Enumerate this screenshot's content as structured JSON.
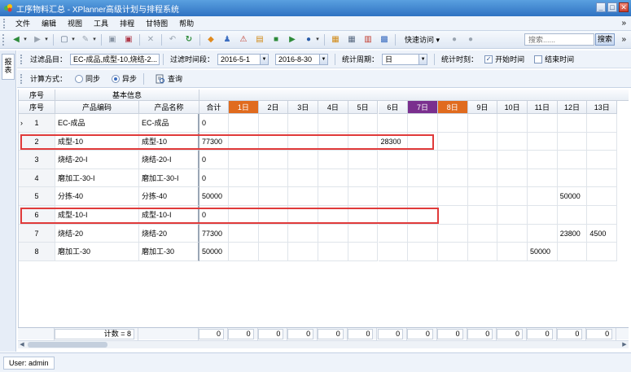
{
  "window": {
    "title": "工序物料汇总 - XPlanner高级计划与排程系统",
    "min": "_",
    "max": "□",
    "close": "✕"
  },
  "menu": [
    "文件",
    "编辑",
    "视图",
    "工具",
    "排程",
    "甘特图",
    "帮助"
  ],
  "toolbar": {
    "quick_access": "快速访问",
    "search_placeholder": "搜索......",
    "search_button": "搜索"
  },
  "side_tab": "报表",
  "filters": {
    "product_label": "过滤品目：",
    "product_value": "EC-成品,成型-10,烧结-2...",
    "period_label": "过滤时间段：",
    "start_date": "2016-5-1",
    "end_date": "2016-8-30",
    "cycle_label": "统计周期：",
    "cycle_value": "日",
    "time_label": "统计时刻：",
    "start_time_label": "开始时间",
    "end_time_label": "结束时间"
  },
  "calc": {
    "mode_label": "计算方式：",
    "sync": "同步",
    "async": "异步",
    "query": "查询"
  },
  "grid": {
    "group_rownum": "序号",
    "group_basic": "基本信息",
    "headers": {
      "seq": "序号",
      "code": "产品编码",
      "name": "产品名称",
      "total": "合计"
    },
    "days": [
      {
        "label": "1日",
        "tone": "orange"
      },
      {
        "label": "2日",
        "tone": ""
      },
      {
        "label": "3日",
        "tone": ""
      },
      {
        "label": "4日",
        "tone": ""
      },
      {
        "label": "5日",
        "tone": ""
      },
      {
        "label": "6日",
        "tone": ""
      },
      {
        "label": "7日",
        "tone": "purple"
      },
      {
        "label": "8日",
        "tone": "orange"
      },
      {
        "label": "9日",
        "tone": ""
      },
      {
        "label": "10日",
        "tone": ""
      },
      {
        "label": "11日",
        "tone": ""
      },
      {
        "label": "12日",
        "tone": ""
      },
      {
        "label": "13日",
        "tone": ""
      }
    ],
    "rows": [
      {
        "seq": "1",
        "code": "EC-成品",
        "name": "EC-成品",
        "total": "0",
        "cells": {}
      },
      {
        "seq": "2",
        "code": "成型-10",
        "name": "成型-10",
        "total": "77300",
        "cells": {
          "5": "28300"
        },
        "highlight": true
      },
      {
        "seq": "3",
        "code": "烧结-20-I",
        "name": "烧结-20-I",
        "total": "0",
        "cells": {}
      },
      {
        "seq": "4",
        "code": "磨加工-30-I",
        "name": "磨加工-30-I",
        "total": "0",
        "cells": {}
      },
      {
        "seq": "5",
        "code": "分拣-40",
        "name": "分拣-40",
        "total": "50000",
        "cells": {
          "11": "50000"
        }
      },
      {
        "seq": "6",
        "code": "成型-10-I",
        "name": "成型-10-I",
        "total": "0",
        "cells": {},
        "highlight": true
      },
      {
        "seq": "7",
        "code": "烧结-20",
        "name": "烧结-20",
        "total": "77300",
        "cells": {
          "11": "23800",
          "12": "4500"
        }
      },
      {
        "seq": "8",
        "code": "磨加工-30",
        "name": "磨加工-30",
        "total": "50000",
        "cells": {
          "10": "50000"
        }
      }
    ],
    "footer": {
      "count": "计数 = 8",
      "total": "0",
      "days": [
        "0",
        "0",
        "0",
        "0",
        "0",
        "0",
        "0",
        "0",
        "0",
        "0",
        "0",
        "0",
        "0"
      ]
    }
  },
  "status": {
    "user": "User: admin"
  }
}
